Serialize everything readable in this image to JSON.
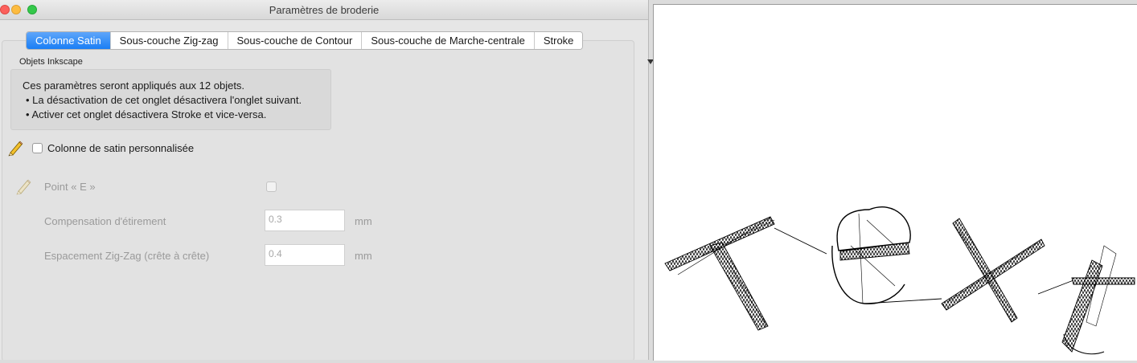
{
  "window": {
    "title": "Paramètres de broderie"
  },
  "tabs": [
    {
      "label": "Colonne Satin",
      "active": true
    },
    {
      "label": "Sous-couche Zig-zag",
      "active": false
    },
    {
      "label": "Sous-couche de Contour",
      "active": false
    },
    {
      "label": "Sous-couche de Marche-centrale",
      "active": false
    },
    {
      "label": "Stroke",
      "active": false
    }
  ],
  "group": {
    "label": "Objets Inkscape",
    "info": {
      "line1": "Ces paramètres seront appliqués aux 12 objets.",
      "line2": "• La désactivation de cet onglet désactivera l'onglet suivant.",
      "line3": "• Activer cet onglet désactivera Stroke et vice-versa."
    }
  },
  "custom_satin": {
    "label": "Colonne de satin personnalisée",
    "checked": false
  },
  "params": {
    "e_stitch": {
      "label": "Point « E »",
      "checked": false
    },
    "pull_compensation": {
      "label": "Compensation d'étirement",
      "value": "0.3",
      "unit": "mm"
    },
    "zigzag_spacing": {
      "label": "Espacement Zig-Zag (crête à crête)",
      "value": "0.4",
      "unit": "mm"
    }
  },
  "icons": {
    "edit": "pencil-icon",
    "edit_disabled": "pencil-icon-disabled"
  },
  "colors": {
    "accent": "#1a7ef5",
    "close": "#fc605c",
    "minimize": "#fdbc40",
    "zoom": "#34c84a"
  }
}
